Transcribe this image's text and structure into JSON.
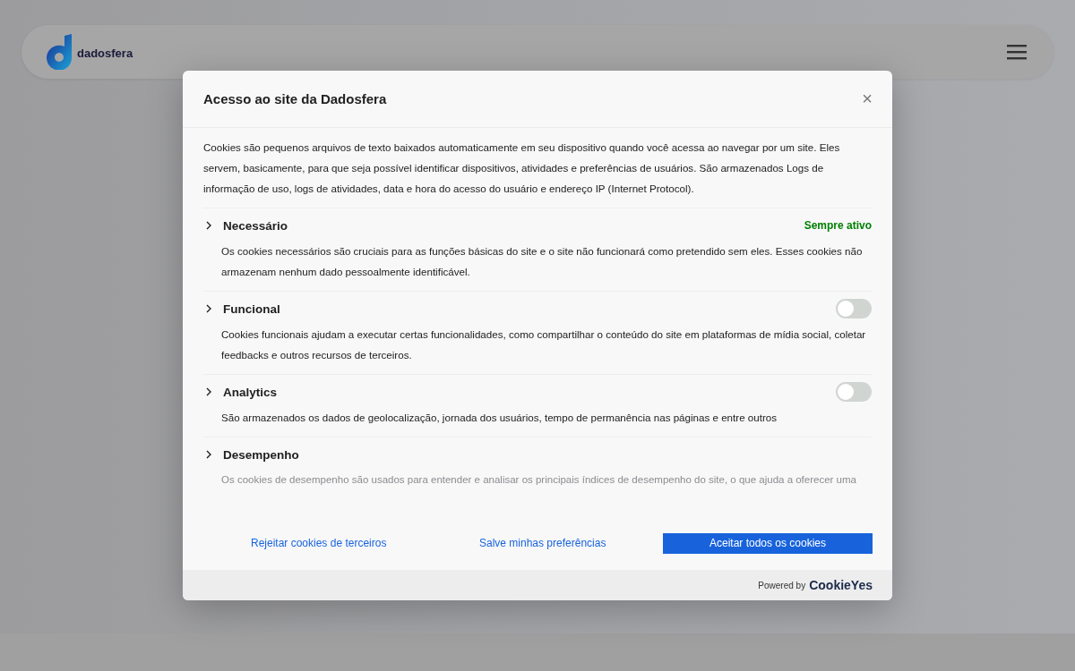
{
  "header": {
    "logo_text": "dadosfera"
  },
  "dialog": {
    "title": "Acesso ao site da Dadosfera",
    "close": "×",
    "intro": "Cookies são pequenos arquivos de texto baixados automaticamente em seu dispositivo quando você acessa ao navegar por um site. Eles servem, basicamente, para que seja possível identificar dispositivos, atividades e preferências de usuários. São armazenados Logs de informação de uso, logs de atividades, data e hora do acesso do usuário e endereço IP (Internet Protocol).",
    "categories": [
      {
        "kind": "always",
        "name": "Necessário",
        "status": "Sempre ativo",
        "description": "Os cookies necessários são cruciais para as funções básicas do site e o site não funcionará como pretendido sem eles. Esses cookies não armazenam nenhum dado pessoalmente identificável."
      },
      {
        "kind": "toggle",
        "name": "Funcional",
        "on": false,
        "description": "Cookies funcionais ajudam a executar certas funcionalidades, como compartilhar o conteúdo do site em plataformas de mídia social, coletar feedbacks e outros recursos de terceiros."
      },
      {
        "kind": "toggle",
        "name": "Analytics",
        "on": false,
        "description": "São armazenados os dados de geolocalização, jornada dos usuários, tempo de permanência nas páginas e entre outros"
      },
      {
        "kind": "plain",
        "name": "Desempenho",
        "description": "Os cookies de desempenho são usados para entender e analisar os principais índices de desempenho do site, o que ajuda a oferecer uma"
      }
    ],
    "buttons": [
      {
        "kind": "link",
        "label": "Rejeitar cookies de terceiros"
      },
      {
        "kind": "link",
        "label": "Salve minhas preferências"
      },
      {
        "kind": "primary",
        "label": "Aceitar todos os cookies"
      }
    ],
    "powered_by": "Powered by",
    "brand": "CookieYes"
  }
}
